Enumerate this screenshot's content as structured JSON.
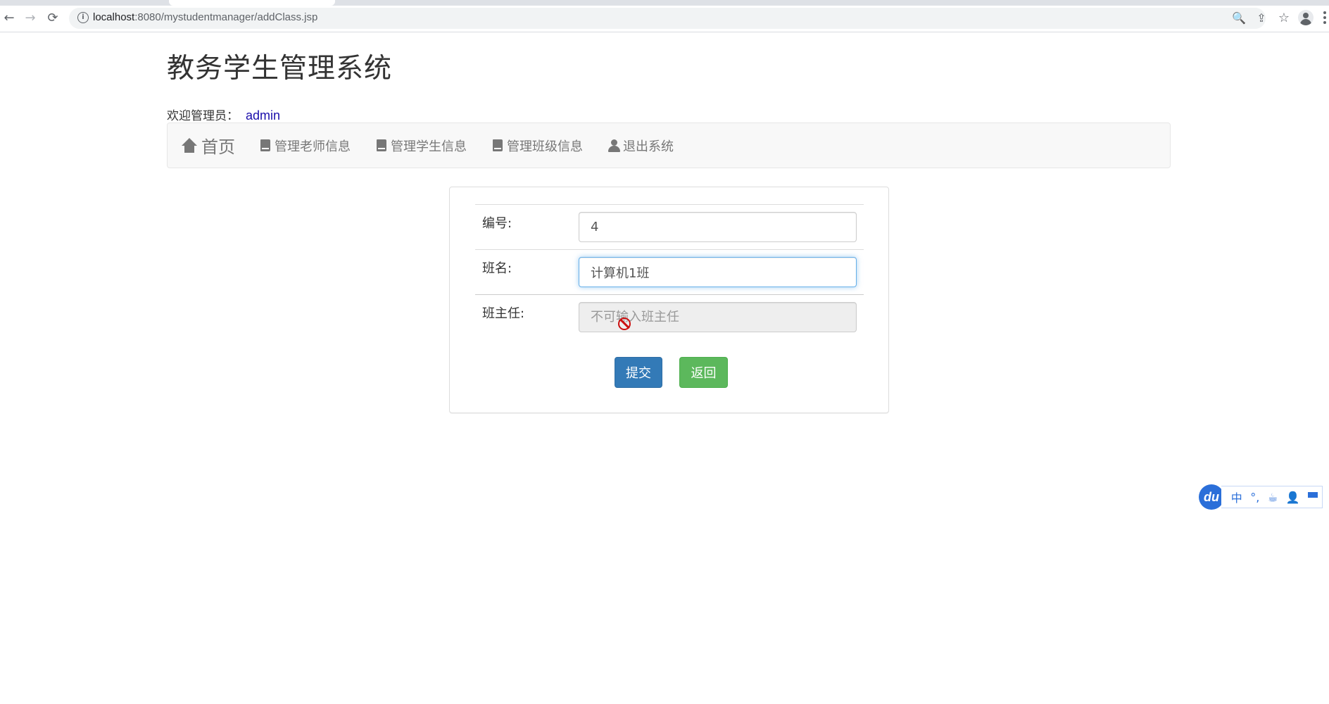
{
  "browser": {
    "url_host": "localhost",
    "url_path": ":8080/mystudentmanager/addClass.jsp",
    "back_icon": "←",
    "forward_icon": "→",
    "reload_icon": "⟳",
    "zoom_icon": "🔍",
    "share_icon": "⇪",
    "star_icon": "☆"
  },
  "header": {
    "title": "教务学生管理系统",
    "welcome_label": "欢迎管理员：",
    "username": "admin"
  },
  "nav": {
    "items": [
      {
        "label": "首页",
        "icon": "home-icon"
      },
      {
        "label": "管理老师信息",
        "icon": "book-icon"
      },
      {
        "label": "管理学生信息",
        "icon": "book-icon"
      },
      {
        "label": "管理班级信息",
        "icon": "book-icon"
      },
      {
        "label": "退出系统",
        "icon": "user-icon"
      }
    ]
  },
  "form": {
    "id_label": "编号:",
    "id_value": "4",
    "name_label": "班名:",
    "name_value": "计算机1班",
    "teacher_label": "班主任:",
    "teacher_placeholder": "不可输入班主任",
    "submit_label": "提交",
    "back_label": "返回"
  },
  "ime": {
    "logo": "du",
    "lang": "中",
    "punct": "°,",
    "icon_names": [
      "du-logo-icon",
      "chinese-mode-icon",
      "punctuation-icon",
      "cup-icon",
      "user-icon",
      "grid-icon"
    ]
  },
  "colors": {
    "primary": "#337ab7",
    "success": "#5cb85c",
    "link": "#1a0dab",
    "ime_blue": "#2b6fd9"
  }
}
